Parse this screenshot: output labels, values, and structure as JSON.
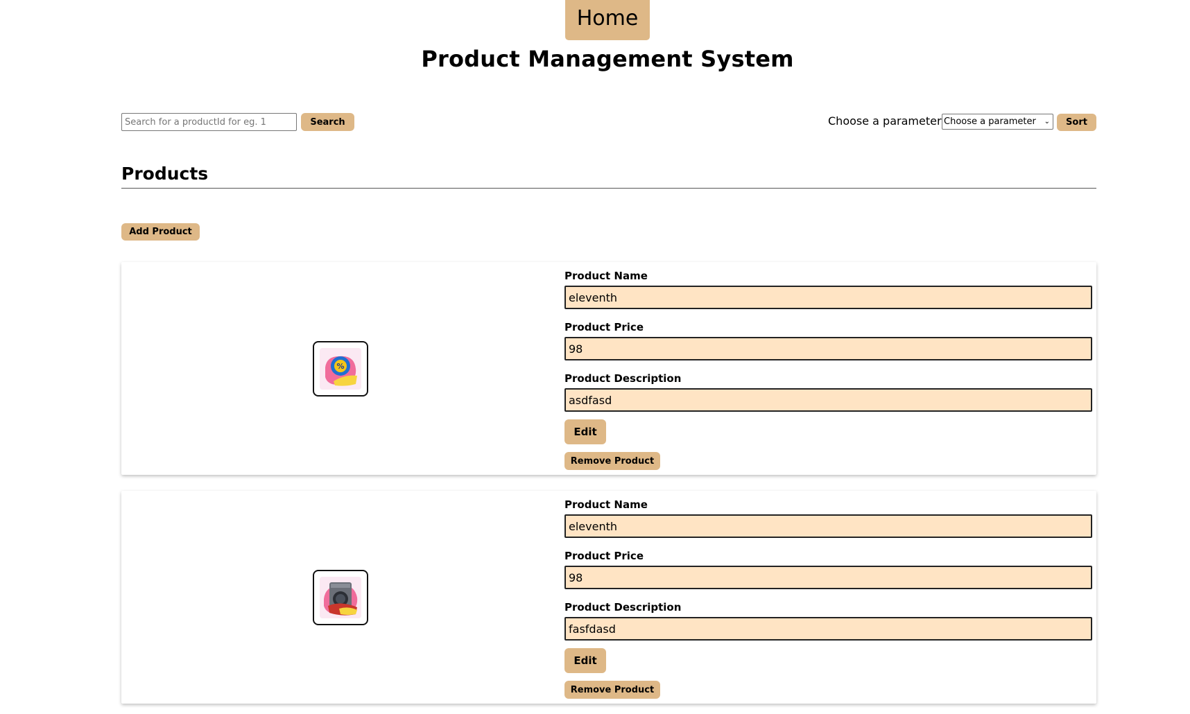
{
  "header": {
    "home_label": "Home",
    "title": "Product Management System"
  },
  "toolbar": {
    "search_placeholder": "Search for a productId for eg. 1",
    "search_label": "Search",
    "sort_prompt": "Choose a parameter",
    "sort_selected": "Choose a parameter",
    "sort_label": "Sort"
  },
  "products_section": {
    "title": "Products",
    "add_label": "Add Product"
  },
  "labels": {
    "name": "Product Name",
    "price": "Product Price",
    "description": "Product Description",
    "edit": "Edit",
    "remove": "Remove Product"
  },
  "products": [
    {
      "name": "eleventh",
      "price": "98",
      "description": "asdfasd",
      "image_icon": "discount-badge-icon"
    },
    {
      "name": "eleventh",
      "price": "98",
      "description": "fasfdasd",
      "image_icon": "washing-machine-icon"
    }
  ],
  "colors": {
    "accent": "#deb887",
    "field_bg": "#ffe4c4"
  }
}
